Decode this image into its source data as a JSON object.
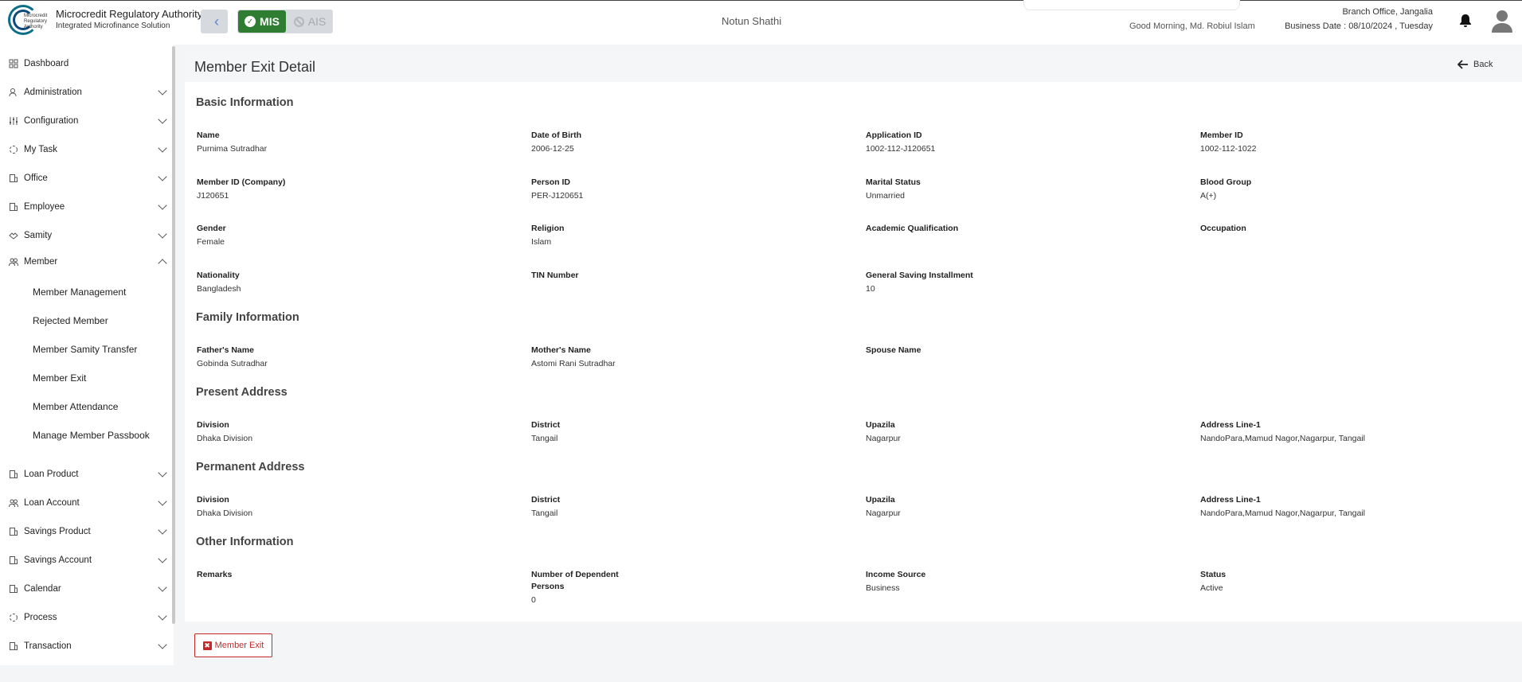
{
  "header": {
    "logo_text": "Microcredit Regulatory Authority",
    "app_title": "Microcredit Regulatory Authority",
    "app_subtitle": "Integrated Microfinance Solution",
    "mode_mis": "MIS",
    "mode_ais": "AIS",
    "org_name": "Notun Shathi",
    "greeting": "Good Morning, Md. Robiul Islam",
    "branch": "Branch Office, Jangalia",
    "business_date": "Business Date : 08/10/2024 , Tuesday"
  },
  "sidebar": {
    "items": [
      {
        "label": "Dashboard"
      },
      {
        "label": "Administration"
      },
      {
        "label": "Configuration"
      },
      {
        "label": "My Task"
      },
      {
        "label": "Office"
      },
      {
        "label": "Employee"
      },
      {
        "label": "Samity"
      },
      {
        "label": "Member"
      },
      {
        "label": "Loan Product"
      },
      {
        "label": "Loan Account"
      },
      {
        "label": "Savings Product"
      },
      {
        "label": "Savings Account"
      },
      {
        "label": "Calendar"
      },
      {
        "label": "Process"
      },
      {
        "label": "Transaction"
      }
    ],
    "member_sub": [
      {
        "label": "Member Management"
      },
      {
        "label": "Rejected Member"
      },
      {
        "label": "Member Samity Transfer"
      },
      {
        "label": "Member Exit"
      },
      {
        "label": "Member Attendance"
      },
      {
        "label": "Manage Member Passbook"
      }
    ]
  },
  "page": {
    "title": "Member Exit Detail",
    "back_label": "Back",
    "exit_label": "Member Exit"
  },
  "sections": {
    "basic": {
      "title": "Basic Information",
      "fields": [
        {
          "label": "Name",
          "value": "Purnima Sutradhar"
        },
        {
          "label": "Date of Birth",
          "value": "2006-12-25"
        },
        {
          "label": "Application ID",
          "value": "1002-112-J120651"
        },
        {
          "label": "Member ID",
          "value": "1002-112-1022"
        },
        {
          "label": "Member ID (Company)",
          "value": "J120651"
        },
        {
          "label": "Person ID",
          "value": "PER-J120651"
        },
        {
          "label": "Marital Status",
          "value": "Unmarried"
        },
        {
          "label": "Blood Group",
          "value": "A(+)"
        },
        {
          "label": "Gender",
          "value": "Female"
        },
        {
          "label": "Religion",
          "value": "Islam"
        },
        {
          "label": "Academic Qualification",
          "value": ""
        },
        {
          "label": "Occupation",
          "value": ""
        },
        {
          "label": "Nationality",
          "value": "Bangladesh"
        },
        {
          "label": "TIN Number",
          "value": ""
        },
        {
          "label": "General Saving Installment",
          "value": "10"
        }
      ]
    },
    "family": {
      "title": "Family Information",
      "fields": [
        {
          "label": "Father's Name",
          "value": "Gobinda Sutradhar"
        },
        {
          "label": "Mother's Name",
          "value": "Astomi Rani Sutradhar"
        },
        {
          "label": "Spouse Name",
          "value": ""
        }
      ]
    },
    "present": {
      "title": "Present Address",
      "fields": [
        {
          "label": "Division",
          "value": "Dhaka Division"
        },
        {
          "label": "District",
          "value": "Tangail"
        },
        {
          "label": "Upazila",
          "value": "Nagarpur"
        },
        {
          "label": "Address Line-1",
          "value": "NandoPara,Mamud Nagor,Nagarpur, Tangail"
        }
      ]
    },
    "permanent": {
      "title": "Permanent Address",
      "fields": [
        {
          "label": "Division",
          "value": "Dhaka Division"
        },
        {
          "label": "District",
          "value": "Tangail"
        },
        {
          "label": "Upazila",
          "value": "Nagarpur"
        },
        {
          "label": "Address Line-1",
          "value": "NandoPara,Mamud Nagor,Nagarpur, Tangail"
        }
      ]
    },
    "other": {
      "title": "Other Information",
      "fields": [
        {
          "label": "Remarks",
          "value": ""
        },
        {
          "label": "Number of Dependent Persons",
          "value": "0"
        },
        {
          "label": "Income Source",
          "value": "Business"
        },
        {
          "label": "Status",
          "value": "Active"
        }
      ]
    }
  }
}
